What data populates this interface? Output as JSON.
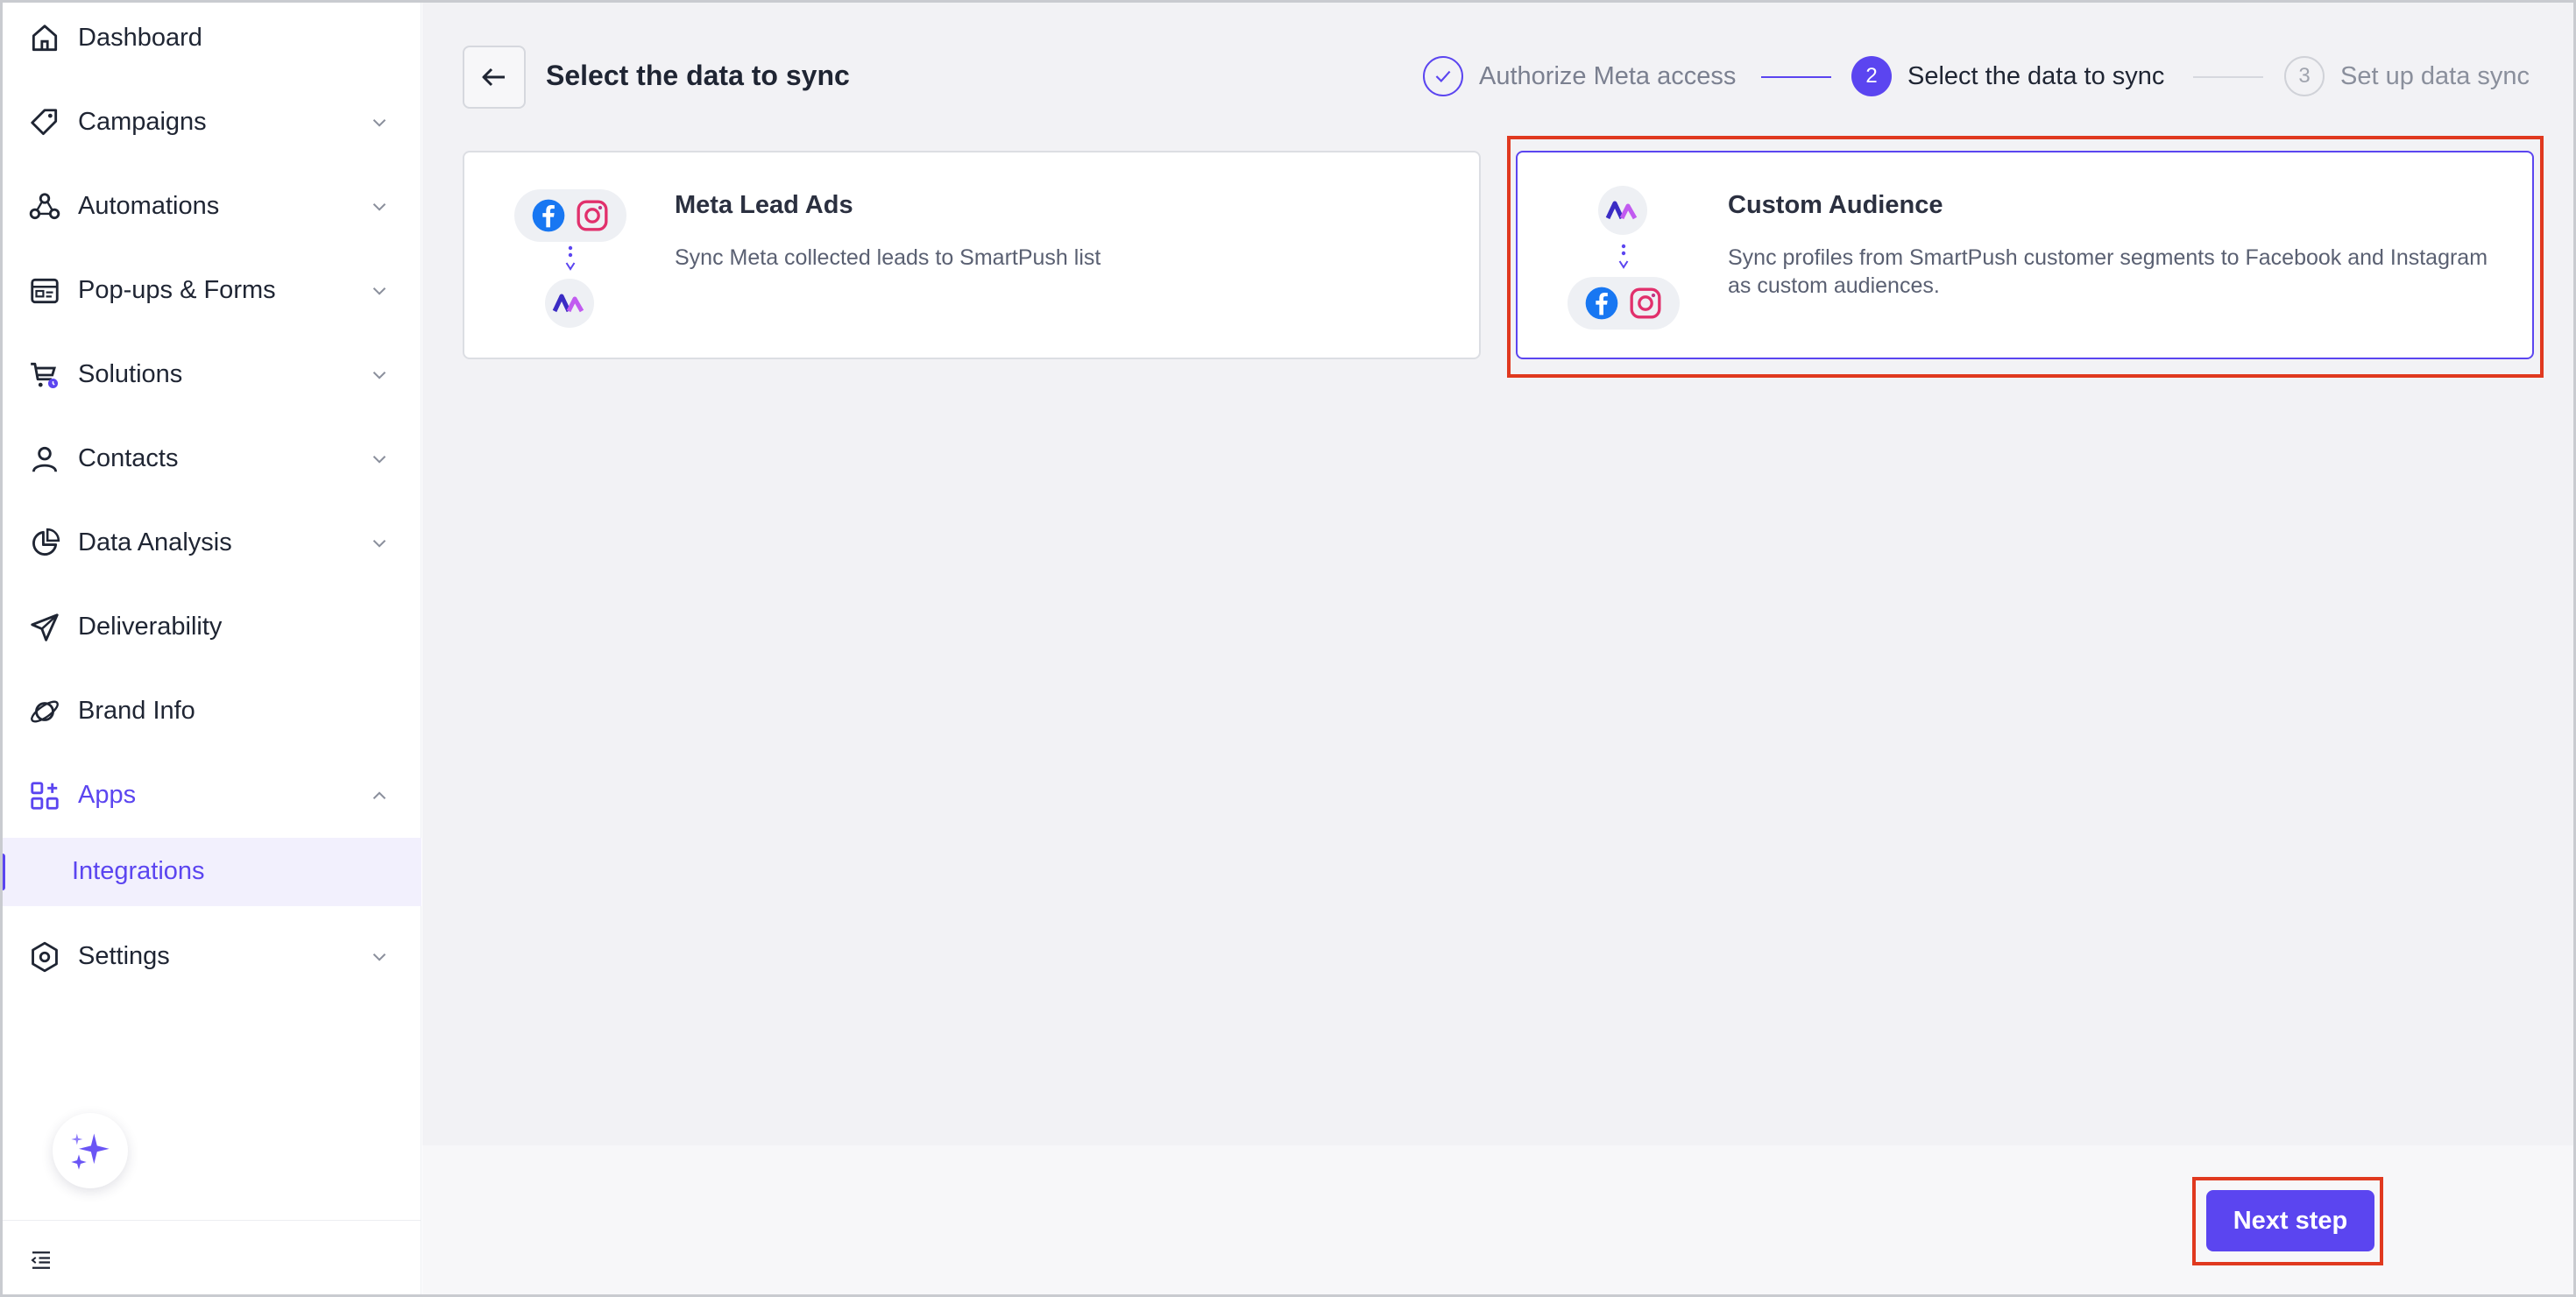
{
  "sidebar": {
    "items": [
      {
        "label": "Dashboard",
        "icon": "home-icon"
      },
      {
        "label": "Campaigns",
        "icon": "tag-icon"
      },
      {
        "label": "Automations",
        "icon": "automation-icon"
      },
      {
        "label": "Pop-ups & Forms",
        "icon": "form-icon"
      },
      {
        "label": "Solutions",
        "icon": "cart-icon"
      },
      {
        "label": "Contacts",
        "icon": "user-icon"
      },
      {
        "label": "Data Analysis",
        "icon": "pie-chart-icon"
      },
      {
        "label": "Deliverability",
        "icon": "send-icon"
      },
      {
        "label": "Brand Info",
        "icon": "planet-icon"
      },
      {
        "label": "Apps",
        "icon": "apps-icon",
        "expanded": true,
        "active": true
      },
      {
        "label": "Settings",
        "icon": "settings-icon"
      }
    ],
    "sub_item": {
      "label": "Integrations",
      "selected": true
    }
  },
  "header": {
    "title": "Select the data to sync"
  },
  "stepper": {
    "steps": [
      {
        "number": "1",
        "label": "Authorize Meta access",
        "state": "done"
      },
      {
        "number": "2",
        "label": "Select the data to sync",
        "state": "current"
      },
      {
        "number": "3",
        "label": "Set up data sync",
        "state": "upcoming"
      }
    ]
  },
  "cards": [
    {
      "title": "Meta Lead Ads",
      "description": "Sync Meta collected leads to SmartPush list",
      "selected": false
    },
    {
      "title": "Custom Audience",
      "description": "Sync profiles from SmartPush customer segments to Facebook and Instagram as custom audiences.",
      "selected": true
    }
  ],
  "footer": {
    "next_label": "Next step"
  },
  "colors": {
    "accent": "#5b45f0",
    "highlight": "#e0391f",
    "facebook": "#1877f2",
    "instagram": "#e1306c"
  }
}
